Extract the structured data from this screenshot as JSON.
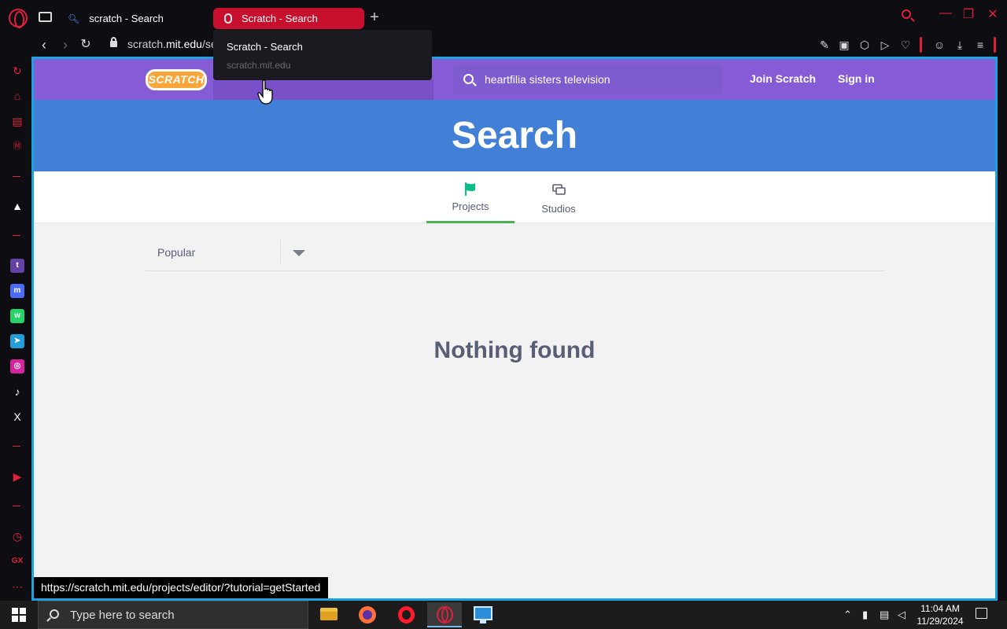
{
  "browser": {
    "tabs": [
      {
        "title": "scratch - Search"
      },
      {
        "title": "Scratch - Search"
      }
    ],
    "url_prefix": "scratch.",
    "url_domain": "mit.edu",
    "url_suffix": "/se",
    "tooltip": {
      "title": "Scratch - Search",
      "url": "scratch.mit.edu"
    },
    "status_url": "https://scratch.mit.edu/projects/editor/?tutorial=getStarted",
    "accent_color": "#e0203c"
  },
  "scratch": {
    "logo": "SCRATCH",
    "search_value": "heartfilia sisters television",
    "join_label": "Join Scratch",
    "signin_label": "Sign in",
    "page_title": "Search",
    "tabs": [
      {
        "label": "Projects",
        "active": true
      },
      {
        "label": "Studios",
        "active": false
      }
    ],
    "sort_selected": "Popular",
    "empty_message": "Nothing found",
    "nav_color": "#855cd6",
    "header_color": "#4280d7"
  },
  "taskbar": {
    "search_placeholder": "Type here to search",
    "time": "11:04 AM",
    "date": "11/29/2024"
  }
}
